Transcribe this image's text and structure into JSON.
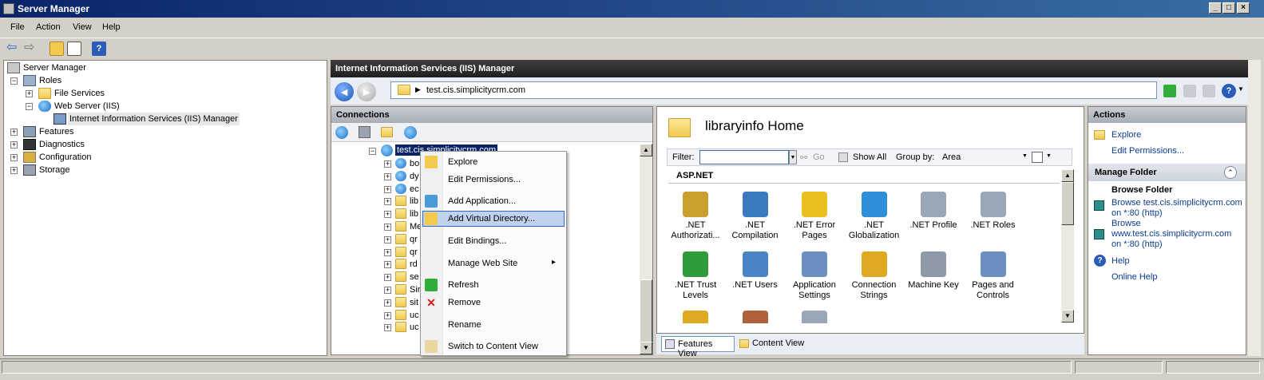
{
  "window": {
    "title": "Server Manager",
    "controls": [
      "_",
      "□",
      "×"
    ]
  },
  "menu": [
    "File",
    "Action",
    "View",
    "Help"
  ],
  "left_tree": [
    {
      "label": "Server Manager",
      "level": 0,
      "expander": ""
    },
    {
      "label": "Roles",
      "level": 1,
      "expander": "−"
    },
    {
      "label": "File Services",
      "level": 2,
      "expander": "+"
    },
    {
      "label": "Web Server (IIS)",
      "level": 2,
      "expander": "−"
    },
    {
      "label": "Internet Information Services (IIS) Manager",
      "level": 3,
      "expander": ""
    },
    {
      "label": "Features",
      "level": 1,
      "expander": "+"
    },
    {
      "label": "Diagnostics",
      "level": 1,
      "expander": "+"
    },
    {
      "label": "Configuration",
      "level": 1,
      "expander": "+"
    },
    {
      "label": "Storage",
      "level": 1,
      "expander": "+"
    }
  ],
  "iis": {
    "header": "Internet Information Services (IIS) Manager",
    "address": "test.cis.simplicitycrm.com",
    "connections_title": "Connections",
    "site_node": "test.cis.simplicitycrm.com",
    "child_nodes": [
      "bo",
      "dy",
      "ec",
      "lib",
      "lib",
      "Me",
      "qr",
      "qr",
      "rd",
      "se",
      "Sir",
      "sit",
      "uc",
      "uc"
    ]
  },
  "context_menu": [
    {
      "label": "Explore",
      "icon": "explore-icon"
    },
    {
      "label": "Edit Permissions...",
      "icon": ""
    },
    {
      "label": "Add Application...",
      "icon": "add-application-icon"
    },
    {
      "label": "Add Virtual Directory...",
      "icon": "add-virtual-directory-icon",
      "highlighted": true
    },
    {
      "label": "Edit Bindings...",
      "icon": ""
    },
    {
      "label": "Manage Web Site",
      "icon": "",
      "submenu": "▸"
    },
    {
      "label": "Refresh",
      "icon": "refresh-icon"
    },
    {
      "label": "Remove",
      "icon": "remove-icon"
    },
    {
      "label": "Rename",
      "icon": ""
    },
    {
      "label": "Switch to Content View",
      "icon": "content-view-icon"
    }
  ],
  "center": {
    "title": "libraryinfo Home",
    "filter_label": "Filter:",
    "go_label": "Go",
    "show_all_label": "Show All",
    "group_by_label": "Group by:",
    "group_by_value": "Area",
    "section": "ASP.NET",
    "tiles": [
      {
        "label": ".NET Authorizati...",
        "icon": "net-authorization-icon",
        "color": "#c9a030"
      },
      {
        "label": ".NET Compilation",
        "icon": "net-compilation-icon",
        "color": "#3a7bbf"
      },
      {
        "label": ".NET Error Pages",
        "icon": "net-error-pages-icon",
        "color": "#e8c020"
      },
      {
        "label": ".NET Globalization",
        "icon": "net-globalization-icon",
        "color": "#2f8fd8"
      },
      {
        "label": ".NET Profile",
        "icon": "net-profile-icon",
        "color": "#9aa7b8"
      },
      {
        "label": ".NET Roles",
        "icon": "net-roles-icon",
        "color": "#9aa7b8"
      },
      {
        "label": ".NET Trust Levels",
        "icon": "net-trust-levels-icon",
        "color": "#2f9a3a"
      },
      {
        "label": ".NET Users",
        "icon": "net-users-icon",
        "color": "#4a84c4"
      },
      {
        "label": "Application Settings",
        "icon": "application-settings-icon",
        "color": "#6a8fc0"
      },
      {
        "label": "Connection Strings",
        "icon": "connection-strings-icon",
        "color": "#e0a820"
      },
      {
        "label": "Machine Key",
        "icon": "machine-key-icon",
        "color": "#8f9aa8"
      },
      {
        "label": "Pages and Controls",
        "icon": "pages-and-controls-icon",
        "color": "#6a8fc0"
      }
    ],
    "view_tabs": [
      "Features View",
      "Content View"
    ]
  },
  "actions": {
    "title": "Actions",
    "explore": "Explore",
    "edit_permissions": "Edit Permissions...",
    "manage_folder": "Manage Folder",
    "browse_folder": "Browse Folder",
    "browse1": "Browse test.cis.simplicitycrm.com on *:80 (http)",
    "browse2_a": "Browse",
    "browse2_b": "www.test.cis.simplicitycrm.com",
    "browse2_c": "on *:80 (http)",
    "help": "Help",
    "online_help": "Online Help"
  }
}
